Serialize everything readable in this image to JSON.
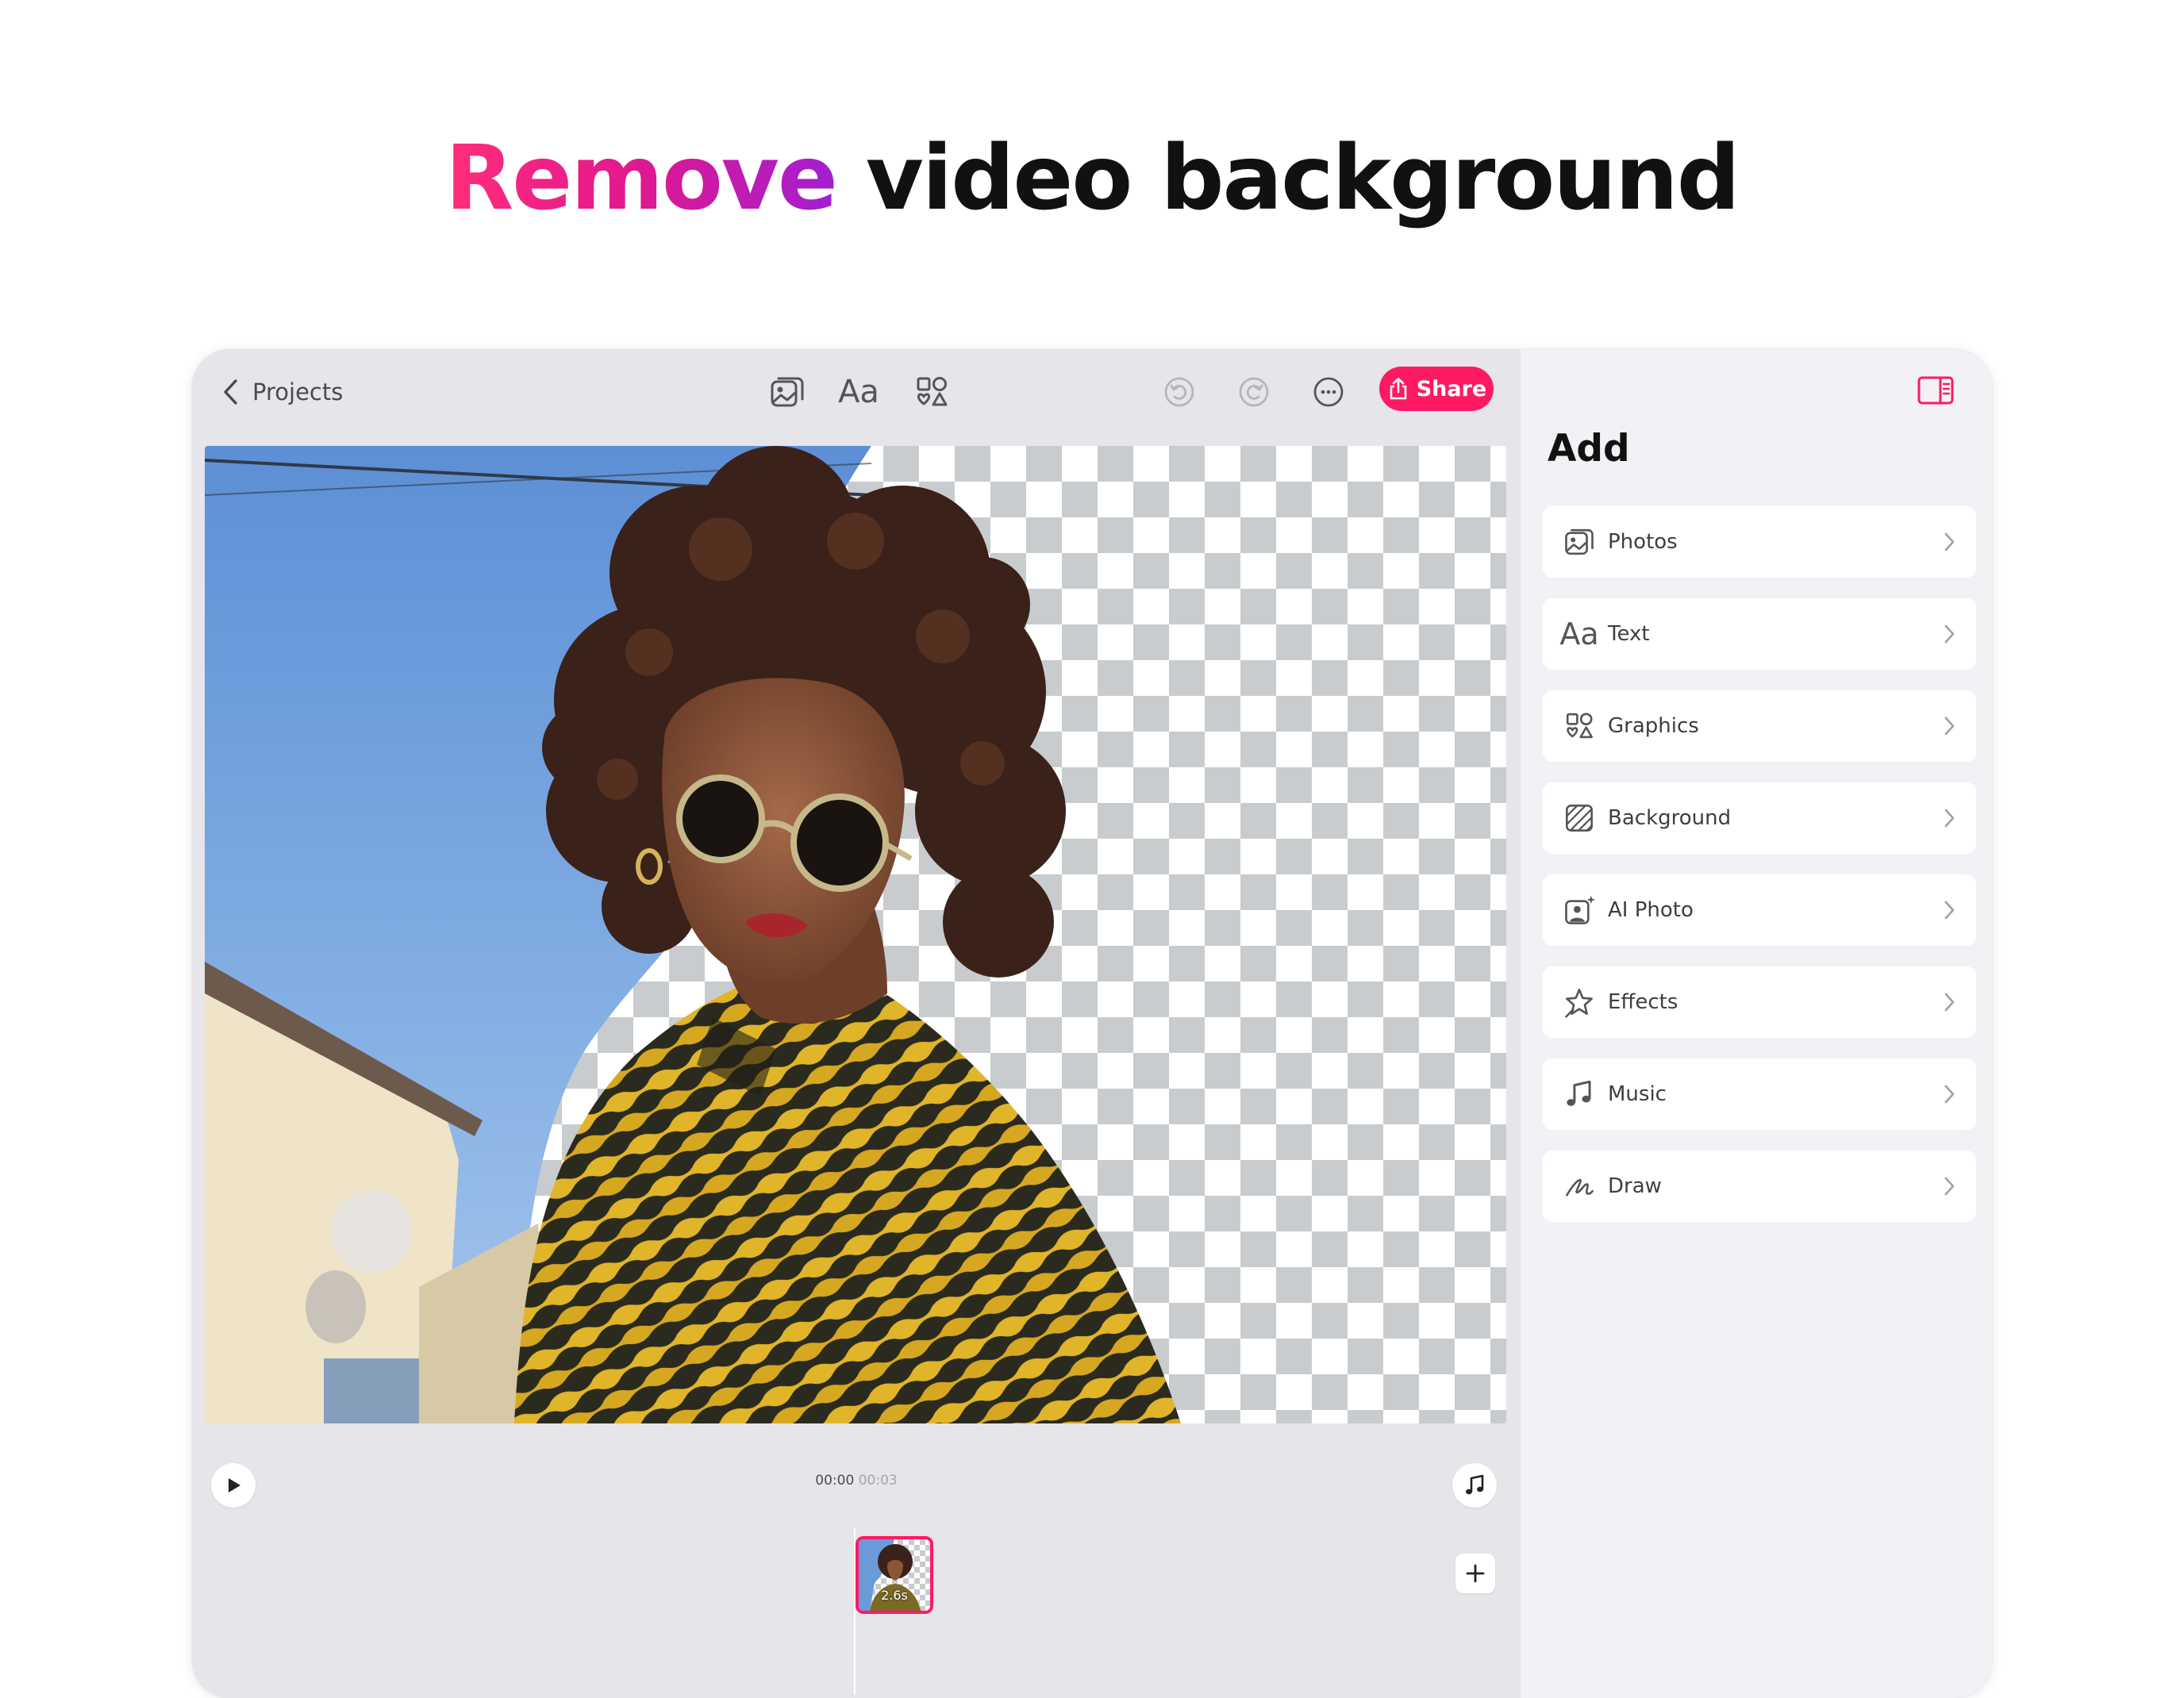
{
  "headline": {
    "accent": "Remove",
    "rest": "video background"
  },
  "toolbar": {
    "back_label": "Projects",
    "text_tool": "Aa",
    "share_label": "Share"
  },
  "timeline": {
    "current_time": "00:00",
    "total_time": "00:03",
    "clip_duration": "2.6s"
  },
  "panel": {
    "title": "Add",
    "items": [
      {
        "label": "Photos",
        "icon": "photos-icon"
      },
      {
        "label": "Text",
        "icon": "text-icon",
        "glyph": "Aa"
      },
      {
        "label": "Graphics",
        "icon": "graphics-icon"
      },
      {
        "label": "Background",
        "icon": "background-icon"
      },
      {
        "label": "AI Photo",
        "icon": "ai-photo-icon"
      },
      {
        "label": "Effects",
        "icon": "effects-icon"
      },
      {
        "label": "Music",
        "icon": "music-icon"
      },
      {
        "label": "Draw",
        "icon": "draw-icon"
      }
    ]
  },
  "colors": {
    "accent": "#fd1a63",
    "gradient_start": "#ff2d7a",
    "gradient_end": "#a11fd2"
  }
}
